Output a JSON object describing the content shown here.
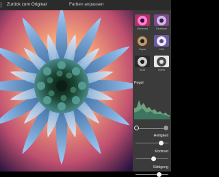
{
  "header": {
    "back_label": "Zurück zum Original",
    "title": "Farben anpassen"
  },
  "filters": [
    {
      "label": "Vibrieend"
    },
    {
      "label": "Farblabel"
    },
    {
      "label": "Sepia"
    },
    {
      "label": "Hell"
    },
    {
      "label": "S&W"
    },
    {
      "label": "Invers"
    }
  ],
  "levels": {
    "title": "Pegel"
  },
  "sliders": {
    "brightness": {
      "label": "Helligkeit",
      "value": 0.78
    },
    "contrast": {
      "label": "Kontrast",
      "value": 0.55
    },
    "saturation": {
      "label": "Sättigung",
      "value": 0.72
    }
  },
  "colors": {
    "background": "#000000",
    "panel": "#3b3b3b",
    "histogram": "#6fa07d"
  }
}
